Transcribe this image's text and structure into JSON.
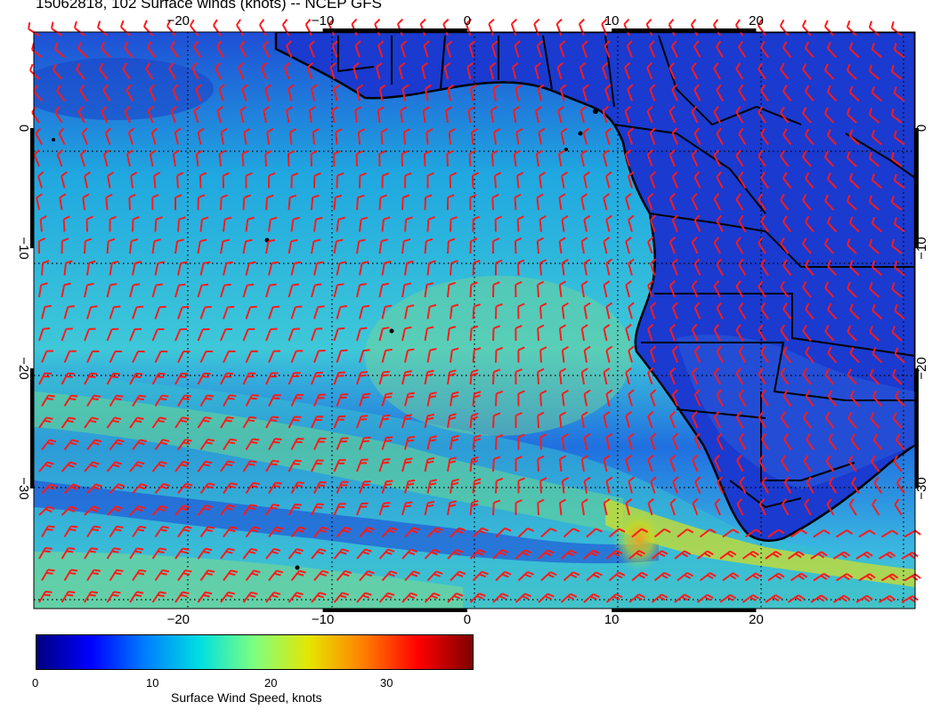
{
  "title": "15062818, 102 Surface winds (knots) -- NCEP GFS",
  "map": {
    "lon_range": [
      -30,
      31
    ],
    "lat_range": [
      8,
      -40
    ],
    "lon_ticks": [
      {
        "value": -20,
        "label": "−20"
      },
      {
        "value": -10,
        "label": "−10"
      },
      {
        "value": 0,
        "label": "0"
      },
      {
        "value": 10,
        "label": "10"
      },
      {
        "value": 20,
        "label": "20"
      }
    ],
    "lat_ticks": [
      {
        "value": 0,
        "label": "0"
      },
      {
        "value": -10,
        "label": "−10"
      },
      {
        "value": -20,
        "label": "−20"
      },
      {
        "value": -30,
        "label": "−30"
      }
    ],
    "barb_color": "#ff1a1a",
    "land_outline_color": "#000000",
    "grid": "dotted"
  },
  "colorbar": {
    "title": "Surface Wind Speed, knots",
    "range": [
      0,
      37
    ],
    "ticks": [
      {
        "value": 0,
        "label": "0"
      },
      {
        "value": 10,
        "label": "10"
      },
      {
        "value": 20,
        "label": "20"
      },
      {
        "value": 30,
        "label": "30"
      }
    ],
    "colors": [
      "#00007f",
      "#0000ff",
      "#007fff",
      "#00e0e0",
      "#7fff7f",
      "#e6e600",
      "#ff7f00",
      "#ff0000",
      "#7f0000"
    ]
  }
}
